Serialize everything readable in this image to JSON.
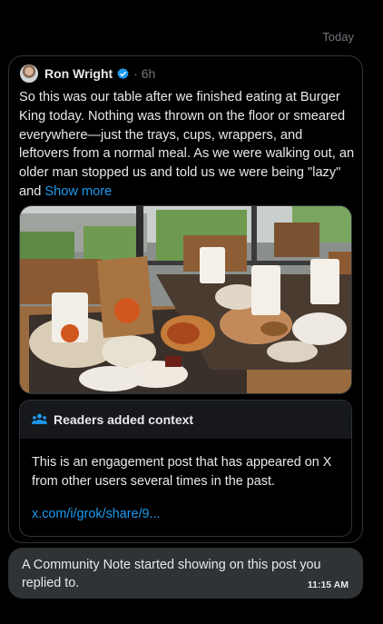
{
  "thread": {
    "date_separator": "Today"
  },
  "post": {
    "author_name": "Ron Wright",
    "verified": true,
    "time_ago": "· 6h",
    "text": "So this was our table after we finished eating at Burger King today. Nothing was thrown on the floor or smeared everywhere—just the trays, cups, wrappers, and leftovers from a normal meal. As we were walking out, an older man stopped us and told us we were being \"lazy\" and ",
    "show_more_label": "Show more",
    "media_icon": "photo-burger-king-table"
  },
  "community_note": {
    "title": "Readers added context",
    "icon": "people-icon",
    "body": "This is an engagement post that has appeared on X from other users several times in the past.",
    "link": "x.com/i/grok/share/9..."
  },
  "message": {
    "text": "A Community Note started showing on this post you replied to.",
    "time": "11:15 AM"
  },
  "colors": {
    "background": "#000000",
    "accent": "#1d9bf0",
    "bubble": "#2f3336",
    "muted": "#71767b"
  }
}
